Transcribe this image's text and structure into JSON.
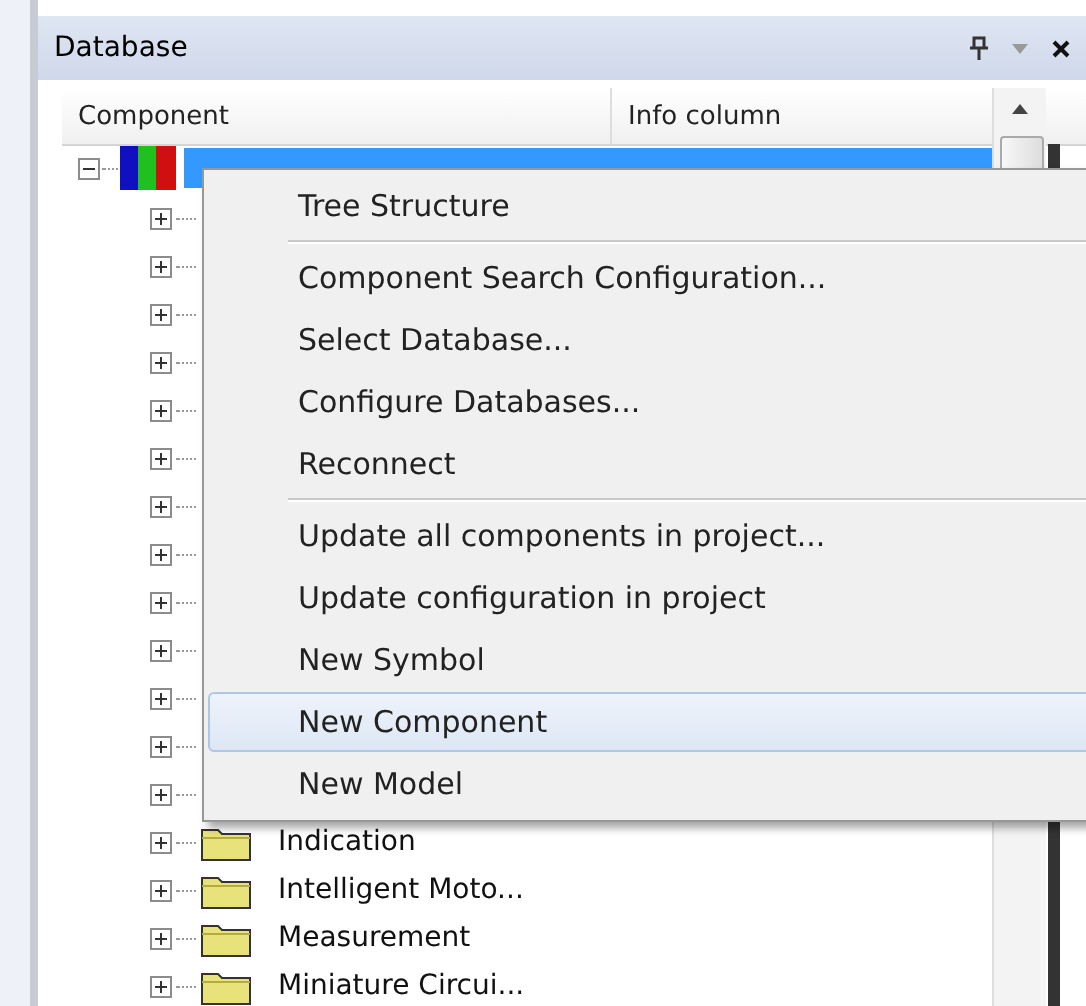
{
  "panel": {
    "title": "Database"
  },
  "columns": [
    "Component",
    "Info column"
  ],
  "tree": {
    "selected": true,
    "expanded": true,
    "children": [
      {
        "expanded": false
      },
      {
        "expanded": false
      },
      {
        "expanded": false
      },
      {
        "expanded": false
      },
      {
        "expanded": false
      },
      {
        "expanded": false
      },
      {
        "expanded": false
      },
      {
        "expanded": false
      },
      {
        "expanded": false
      },
      {
        "expanded": false
      },
      {
        "expanded": false
      },
      {
        "expanded": false
      },
      {
        "expanded": false
      },
      {
        "label": "Indication",
        "expanded": false
      },
      {
        "label": "Intelligent Moto...",
        "expanded": false
      },
      {
        "label": "Measurement",
        "expanded": false
      },
      {
        "label": "Miniature Circui...",
        "expanded": false
      }
    ]
  },
  "context_menu": [
    {
      "kind": "item",
      "label": "Tree Structure",
      "selected": false
    },
    {
      "kind": "separator"
    },
    {
      "kind": "item",
      "label": "Component Search Configuration...",
      "selected": false
    },
    {
      "kind": "item",
      "label": "Select Database...",
      "selected": false
    },
    {
      "kind": "item",
      "label": "Configure Databases...",
      "selected": false
    },
    {
      "kind": "item",
      "label": "Reconnect",
      "selected": false
    },
    {
      "kind": "separator"
    },
    {
      "kind": "item",
      "label": "Update all components in project...",
      "selected": false
    },
    {
      "kind": "item",
      "label": "Update configuration in project",
      "selected": false
    },
    {
      "kind": "item",
      "label": "New Symbol",
      "selected": false
    },
    {
      "kind": "item",
      "label": "New Component",
      "selected": true
    },
    {
      "kind": "item",
      "label": "New Model",
      "selected": false
    }
  ]
}
